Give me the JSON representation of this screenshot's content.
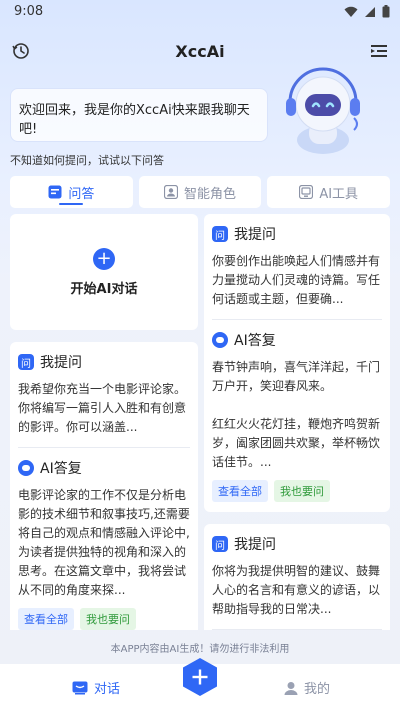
{
  "status_bar": {
    "time": "9:08"
  },
  "header": {
    "title": "XccAi"
  },
  "welcome": {
    "text": "欢迎回来，我是你的XccAi快来跟我聊天吧!"
  },
  "hint": "不知道如何提问，试试以下问答",
  "tabs": [
    {
      "label": "问答",
      "icon": "chat-icon",
      "active": true
    },
    {
      "label": "智能角色",
      "icon": "role-icon",
      "active": false
    },
    {
      "label": "AI工具",
      "icon": "tool-icon",
      "active": false
    }
  ],
  "start_card": {
    "label": "开始AI对话"
  },
  "labels": {
    "question": "我提问",
    "answer": "AI答复",
    "view_all": "查看全部",
    "ask_too": "我也要问"
  },
  "left_cards": [
    {
      "question": "我希望你充当一个电影评论家。你将编写一篇引人入胜和有创意的影评。你可以涵盖...",
      "answer": "电影评论家的工作不仅是分析电影的技术细节和叙事技巧,还需要将自己的观点和情感融入评论中,为读者提供独特的视角和深入的思考。在这篇文章中，我将尝试从不同的角度来探..."
    }
  ],
  "right_cards": [
    {
      "question": "你要创作出能唤起人们情感并有力量搅动人们灵魂的诗篇。写任何话题或主题，但要确...",
      "answer": "春节钟声响，喜气洋洋起，千门万户开，笑迎春风来。\n\n红红火火花灯挂，鞭炮齐鸣贺新岁，阖家团圆共欢聚，举杯畅饮话佳节。..."
    },
    {
      "question": "你将为我提供明智的建议、鼓舞人心的名言和有意义的谚语，以帮助指导我的日常决...",
      "answer": ""
    }
  ],
  "notice": "本APP内容由AI生成！请勿进行非法利用",
  "nav": {
    "chat": "对话",
    "me": "我的"
  },
  "colors": {
    "accent": "#2f67f5",
    "ask_green": "#2f9a3a"
  }
}
